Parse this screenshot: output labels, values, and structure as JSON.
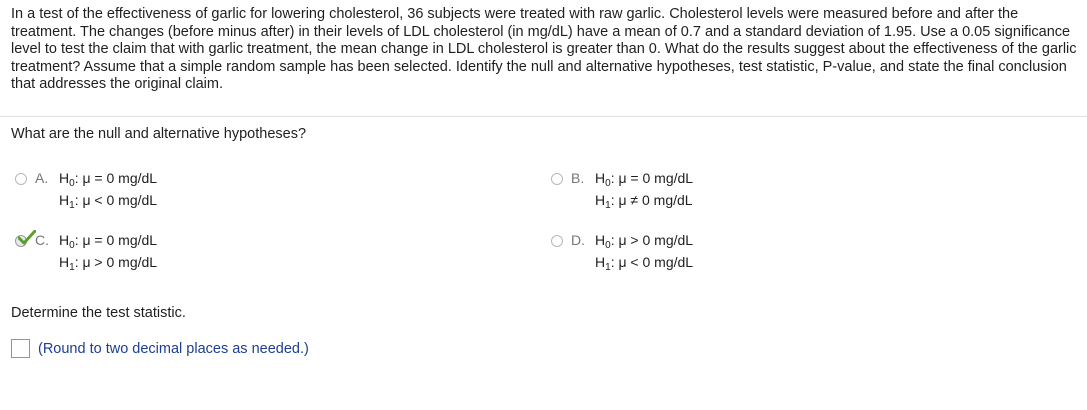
{
  "question": {
    "text": "In a test of the effectiveness of garlic for lowering cholesterol, 36 subjects were treated with raw garlic. Cholesterol levels were measured before and after the treatment. The changes (before minus after) in their levels of LDL cholesterol (in mg/dL) have a mean of 0.7 and a standard deviation of 1.95. Use a 0.05 significance level to test the claim that with garlic treatment, the mean change in LDL cholesterol is greater than 0. What do the results suggest about the effectiveness of the garlic treatment? Assume that a simple random sample has been selected. Identify the null and alternative hypotheses, test statistic, P-value, and state the final conclusion that addresses the original claim."
  },
  "part1": {
    "prompt": "What are the null and alternative hypotheses?",
    "choices": [
      {
        "letter": "A.",
        "h0_label": "H",
        "h0_sub": "0",
        "h0_rest": ": μ = 0 mg/dL",
        "h1_label": "H",
        "h1_sub": "1",
        "h1_rest": ": μ < 0 mg/dL",
        "selected": false
      },
      {
        "letter": "B.",
        "h0_label": "H",
        "h0_sub": "0",
        "h0_rest": ": μ = 0 mg/dL",
        "h1_label": "H",
        "h1_sub": "1",
        "h1_rest": ": μ ≠ 0 mg/dL",
        "selected": false
      },
      {
        "letter": "C.",
        "h0_label": "H",
        "h0_sub": "0",
        "h0_rest": ": μ = 0 mg/dL",
        "h1_label": "H",
        "h1_sub": "1",
        "h1_rest": ": μ > 0 mg/dL",
        "selected": true
      },
      {
        "letter": "D.",
        "h0_label": "H",
        "h0_sub": "0",
        "h0_rest": ": μ > 0 mg/dL",
        "h1_label": "H",
        "h1_sub": "1",
        "h1_rest": ": μ < 0 mg/dL",
        "selected": false
      }
    ],
    "correct_icon": "checkmark-icon",
    "correct_color": "#5aa02c"
  },
  "part2": {
    "prompt": "Determine the test statistic.",
    "input_value": "",
    "hint": "(Round to two decimal places as needed.)"
  }
}
